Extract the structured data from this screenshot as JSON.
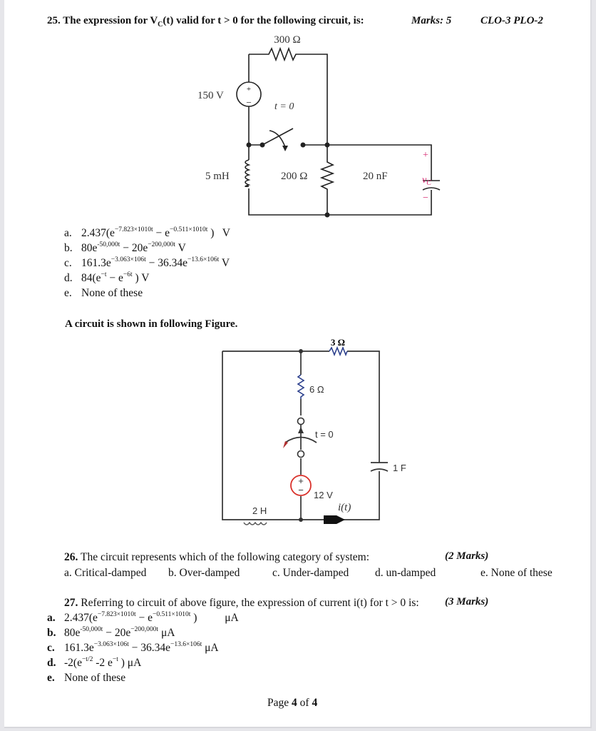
{
  "q25": {
    "number": "25.",
    "text_before": "The expression for V",
    "subscript": "C",
    "text_after": "(t) valid for t > 0 for the following circuit, is:",
    "marks": "Marks: 5",
    "clo": "CLO-3 PLO-2",
    "circuit": {
      "r_top": "300 Ω",
      "source": "150 V",
      "switch": "t = 0",
      "inductor": "5 mH",
      "r_mid": "200 Ω",
      "capacitor": "20 nF",
      "vc_label": "v",
      "vc_sub": "C",
      "plus": "+",
      "minus": "−"
    },
    "options": [
      {
        "label": "a.",
        "pre": "2.437(e",
        "e1": "−7.823×1010t",
        "mid": " − e",
        "e2": "−0.511×1010t",
        "post": " )   V"
      },
      {
        "label": "b.",
        "pre": "80e",
        "e1": "-50,000t",
        "mid": " − 20e",
        "e2": "−200,000t",
        "post": " V"
      },
      {
        "label": "c.",
        "pre": "161.3e",
        "e1": "−3.063×106t",
        "mid": " − 36.34e",
        "e2": "−13.6×106t",
        "post": " V"
      },
      {
        "label": "d.",
        "pre": "84(e",
        "e1": "−t",
        "mid": " − e",
        "e2": "−6t",
        "post": " ) V"
      },
      {
        "label": "e.",
        "pre": "None of these",
        "e1": "",
        "mid": "",
        "e2": "",
        "post": ""
      }
    ]
  },
  "intro": "A circuit is shown in following Figure.",
  "circuit2": {
    "r_top": "3 Ω",
    "r_mid": "6 Ω",
    "switch": "t = 0",
    "capacitor": "1 F",
    "source": "12 V",
    "inductor": "2 H",
    "current": "i(t)"
  },
  "q26": {
    "number": "26.",
    "text": "The circuit represents which of the following category of system:",
    "marks": "(2 Marks)",
    "options": [
      "a.   Critical-damped",
      "b. Over-damped",
      "c. Under-damped",
      "d. un-damped",
      "e. None of these"
    ]
  },
  "q27": {
    "number": "27.",
    "text": "Referring to circuit of above figure, the expression of current i(t) for t > 0 is:",
    "marks": "(3 Marks)",
    "options": [
      {
        "label": "a.",
        "pre": "2.437(e",
        "e1": "−7.823×1010t",
        "mid": " − e",
        "e2": "−0.511×1010t",
        "post": " )          μA"
      },
      {
        "label": "b.",
        "pre": "80e",
        "e1": "-50,000t",
        "mid": " − 20e",
        "e2": "−200,000t",
        "post": " μA"
      },
      {
        "label": "c.",
        "pre": "161.3e",
        "e1": "−3.063×106t",
        "mid": " − 36.34e",
        "e2": "−13.6×106t",
        "post": " μA"
      },
      {
        "label": "d.",
        "pre": "-2(e",
        "e1": "−t/2",
        "mid": " -2 e",
        "e2": "−t",
        "post": " ) μA"
      },
      {
        "label": "e.",
        "pre": "None of these",
        "e1": "",
        "mid": "",
        "e2": "",
        "post": ""
      }
    ]
  },
  "footer": {
    "prefix": "Page ",
    "current": "4",
    "middle": " of ",
    "total": "4"
  },
  "colors": {
    "vc_label": "#d6246e",
    "source2_ring": "#d9312b",
    "resistor2": "#2b3f8c"
  }
}
